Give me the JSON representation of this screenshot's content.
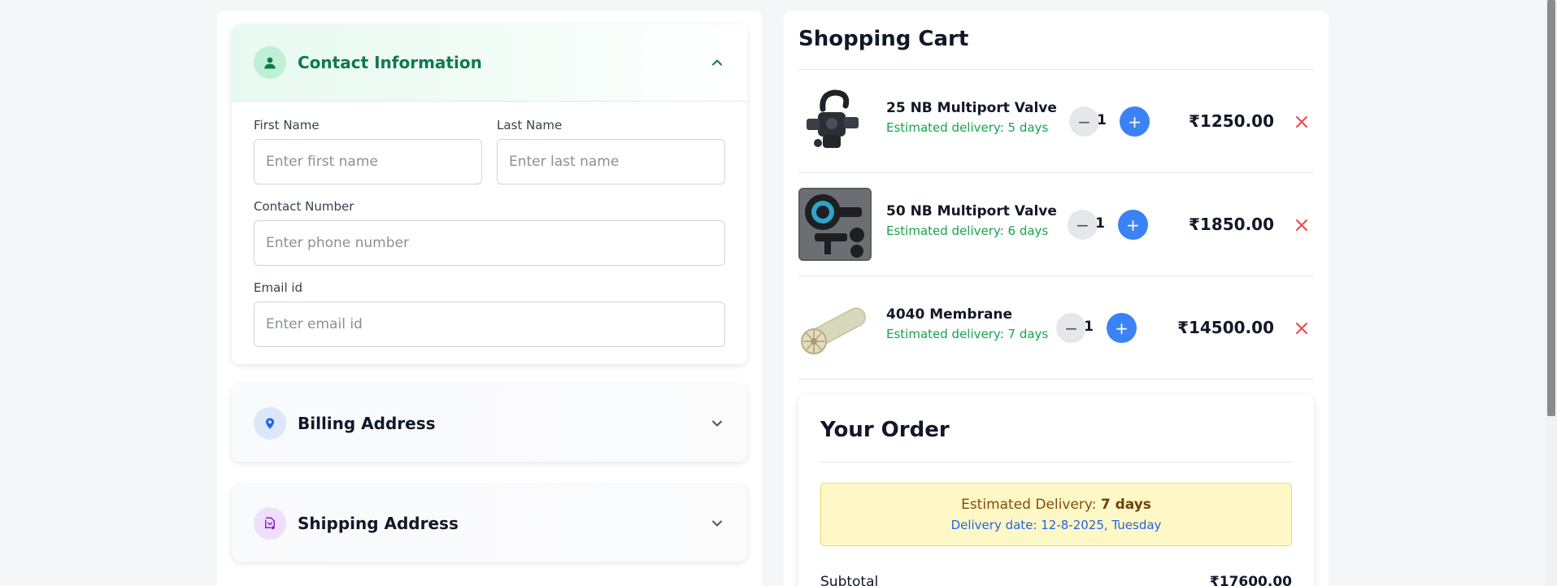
{
  "contact": {
    "title": "Contact Information",
    "first_name_label": "First Name",
    "first_name_placeholder": "Enter first name",
    "last_name_label": "Last Name",
    "last_name_placeholder": "Enter last name",
    "phone_label": "Contact Number",
    "phone_placeholder": "Enter phone number",
    "email_label": "Email id",
    "email_placeholder": "Enter email id",
    "icon": "user-icon",
    "expanded": true
  },
  "billing": {
    "title": "Billing Address",
    "icon": "location-pin-icon",
    "expanded": false
  },
  "shipping": {
    "title": "Shipping Address",
    "icon": "shipping-icon",
    "expanded": false
  },
  "cart": {
    "title": "Shopping Cart",
    "items": [
      {
        "name": "25 NB Multiport Valve",
        "delivery": "Estimated delivery: 5 days",
        "qty": "1",
        "price": "₹1250.00"
      },
      {
        "name": "50 NB Multiport Valve",
        "delivery": "Estimated delivery: 6 days",
        "qty": "1",
        "price": "₹1850.00"
      },
      {
        "name": "4040 Membrane",
        "delivery": "Estimated delivery: 7 days",
        "qty": "1",
        "price": "₹14500.00"
      }
    ],
    "minus_glyph": "−",
    "plus_glyph": "+"
  },
  "order": {
    "title": "Your Order",
    "estimated_label": "Estimated Delivery: ",
    "estimated_value": "7 days",
    "delivery_date": "Delivery date: 12-8-2025, Tuesday",
    "subtotal_label": "Subtotal",
    "subtotal_value": "₹17600.00"
  },
  "colors": {
    "accent_green": "#0f7a4b",
    "delivery_green": "#16a34a",
    "plus_blue": "#3b82f6",
    "remove_red": "#ef4444"
  }
}
